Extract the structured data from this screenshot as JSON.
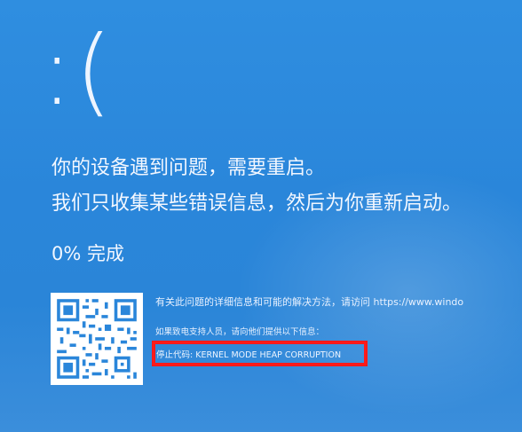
{
  "screen": {
    "sad_face": ":(",
    "message_line1": "你的设备遇到问题，需要重启。",
    "message_line2": "我们只收集某些错误信息，然后为你重新启动。",
    "progress_text": "0% 完成",
    "info_line": "有关此问题的详细信息和可能的解决方法，请访问 https://www.windo",
    "support_line": "如果致电支持人员，请向他们提供以下信息：",
    "stop_code": "停止代码: KERNEL MODE HEAP CORRUPTION"
  },
  "colors": {
    "background": "#2a86da",
    "text": "#f2f7ff",
    "highlight": "#ff1a1a"
  },
  "icons": {
    "qr_code": "qr-code-icon"
  }
}
